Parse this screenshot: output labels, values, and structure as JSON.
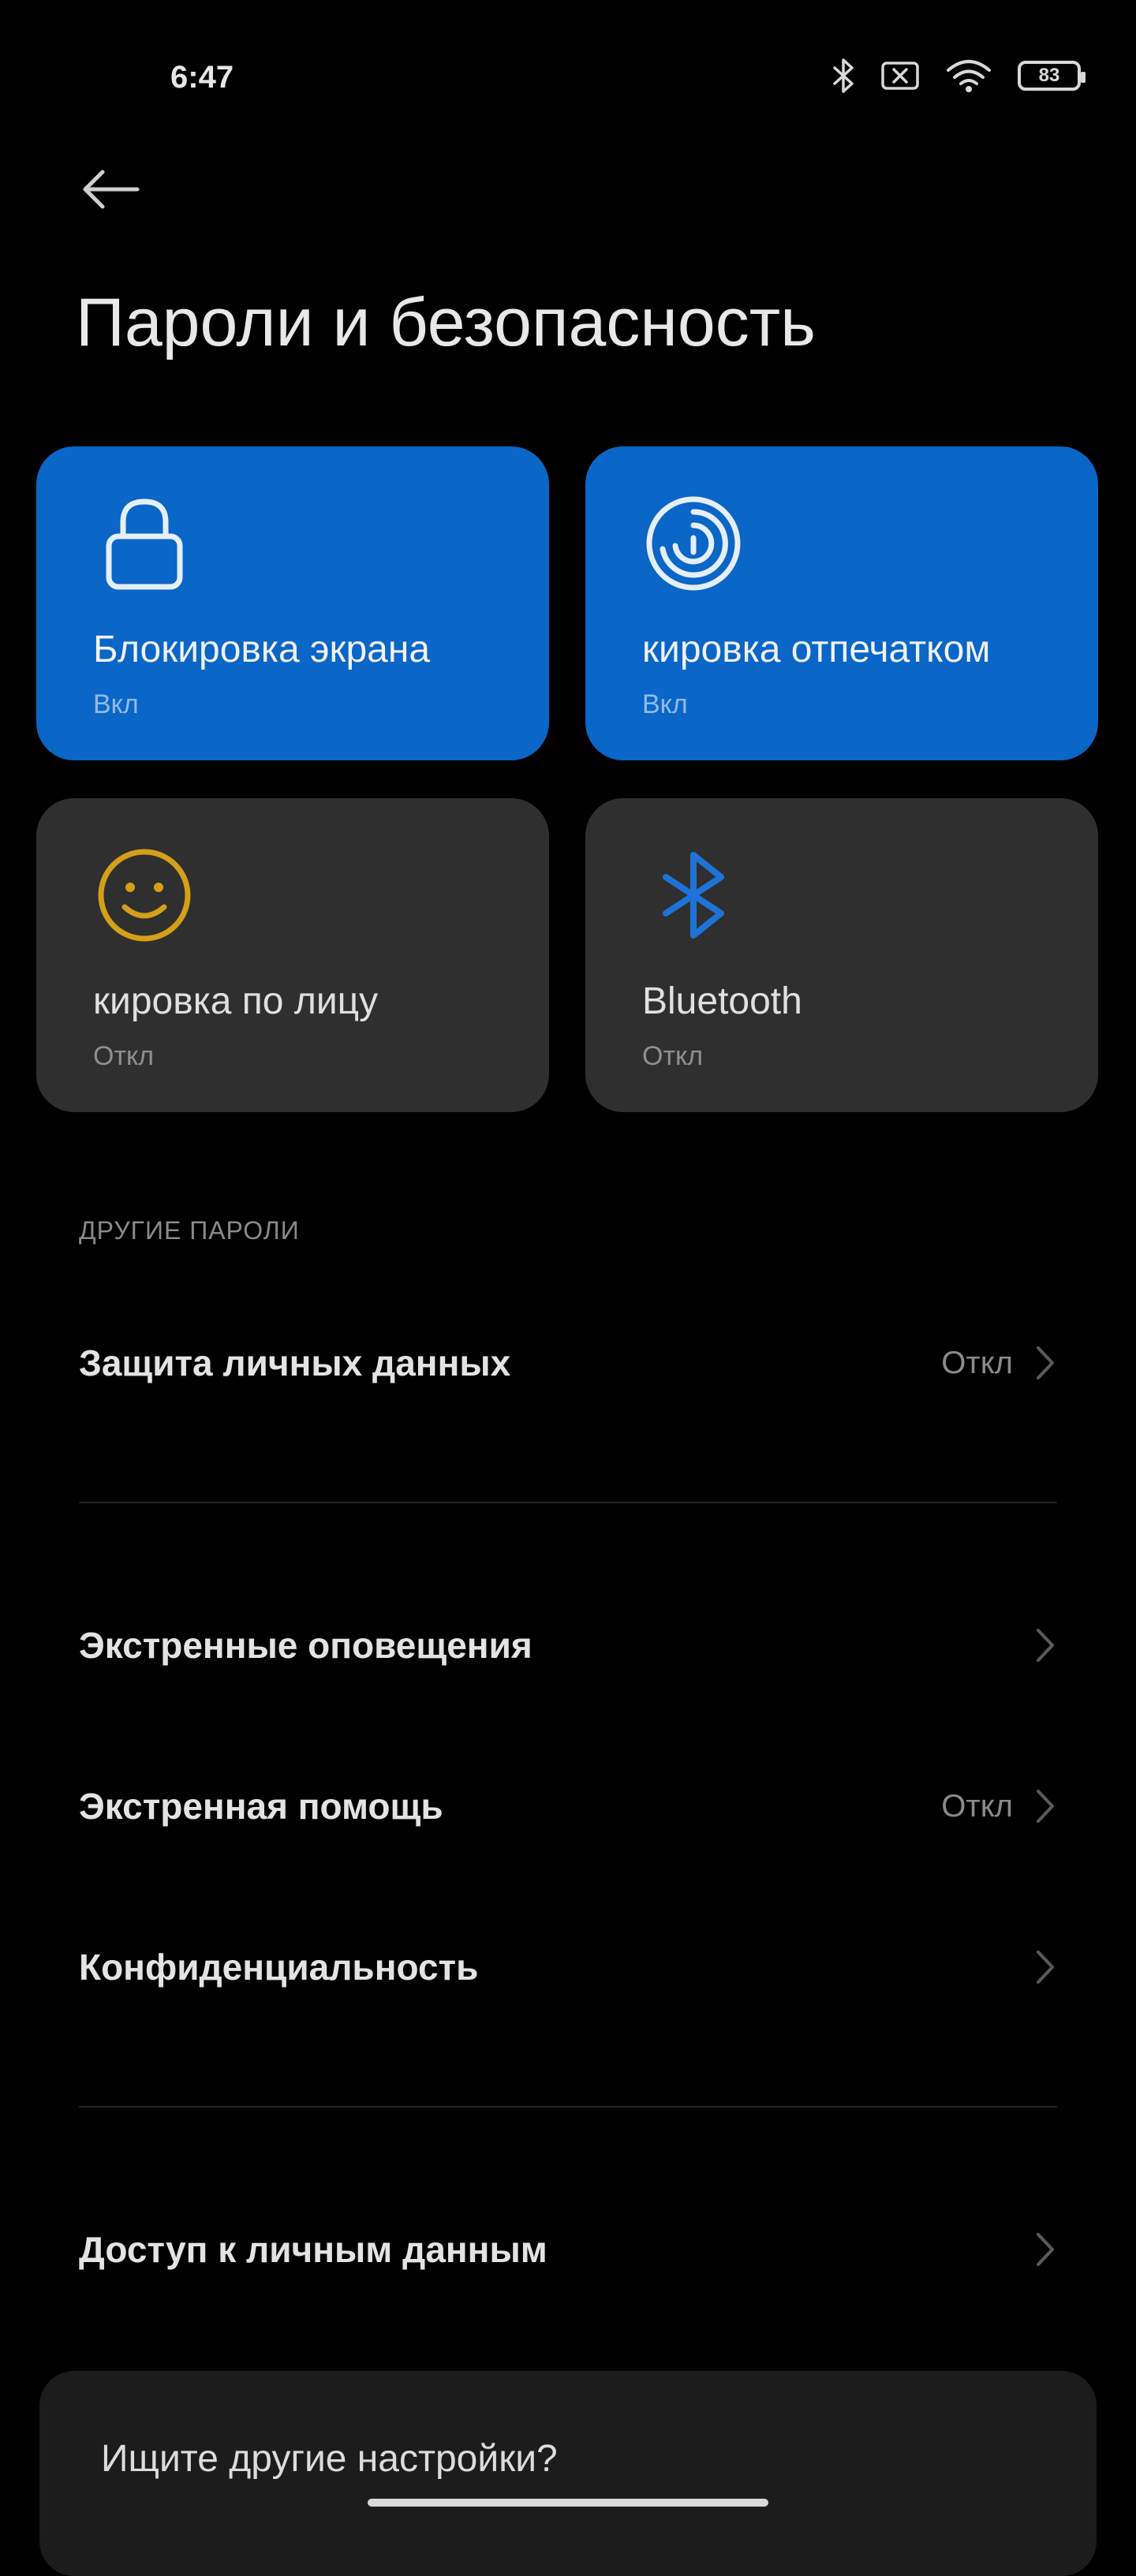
{
  "status_bar": {
    "time": "6:47",
    "battery_level": "83",
    "icons": [
      "bluetooth-icon",
      "sim-off-icon",
      "wifi-icon",
      "battery-icon"
    ]
  },
  "header": {
    "title": "Пароли и безопасность"
  },
  "tiles": [
    {
      "label": "Блокировка экрана",
      "status": "Вкл",
      "icon": "lock-icon",
      "active": true
    },
    {
      "label": "кировка отпечатком",
      "status": "Вкл",
      "icon": "fingerprint-icon",
      "active": true
    },
    {
      "label": "кировка по лицу",
      "status": "Откл",
      "icon": "face-icon",
      "active": false
    },
    {
      "label": "Bluetooth",
      "status": "Откл",
      "icon": "bluetooth-icon",
      "active": false
    }
  ],
  "section_other_passwords": {
    "header": "ДРУГИЕ ПАРОЛИ",
    "items": [
      {
        "label": "Защита личных данных",
        "value": "Откл"
      }
    ]
  },
  "list_items": [
    {
      "label": "Экстренные оповещения",
      "value": ""
    },
    {
      "label": "Экстренная помощь",
      "value": "Откл"
    },
    {
      "label": "Конфиденциальность",
      "value": ""
    }
  ],
  "list_items_2": [
    {
      "label": "Доступ к личным данным",
      "value": ""
    }
  ],
  "search_card": {
    "text": "Ищите другие настройки?"
  },
  "colors": {
    "tile_active": "#0a66c7",
    "tile_inactive": "#2f2f2f",
    "face_icon": "#d4a017",
    "bluetooth_icon": "#1e73d8"
  }
}
